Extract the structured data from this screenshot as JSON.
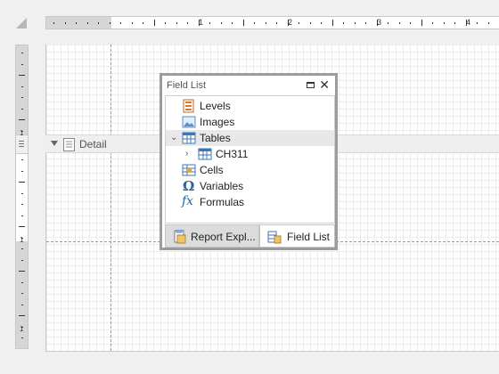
{
  "ruler": {
    "h_numbers": [
      "1",
      "2",
      "3",
      "4"
    ],
    "v_numbers": [
      "1",
      "1",
      "1"
    ]
  },
  "band": {
    "label": "Detail"
  },
  "field_list": {
    "title": "Field List",
    "tree": [
      {
        "label": "Levels",
        "icon": "levels-icon"
      },
      {
        "label": "Images",
        "icon": "images-icon"
      },
      {
        "label": "Tables",
        "icon": "table-icon",
        "expanded": true
      },
      {
        "label": "CH311",
        "icon": "table-icon",
        "collapsed": true
      },
      {
        "label": "Cells",
        "icon": "cells-icon"
      },
      {
        "label": "Variables",
        "icon": "omega-icon"
      },
      {
        "label": "Formulas",
        "icon": "fx-icon"
      }
    ],
    "tabs": [
      {
        "label": "Report Expl...",
        "icon": "report-explorer-icon"
      },
      {
        "label": "Field List",
        "icon": "field-list-icon",
        "active": true
      }
    ]
  },
  "colors": {
    "panel_border": "#9c9c9c",
    "selected_row": "#e8e8e8",
    "ruler_margin": "#d6d6d6",
    "grid": "#ececec"
  }
}
